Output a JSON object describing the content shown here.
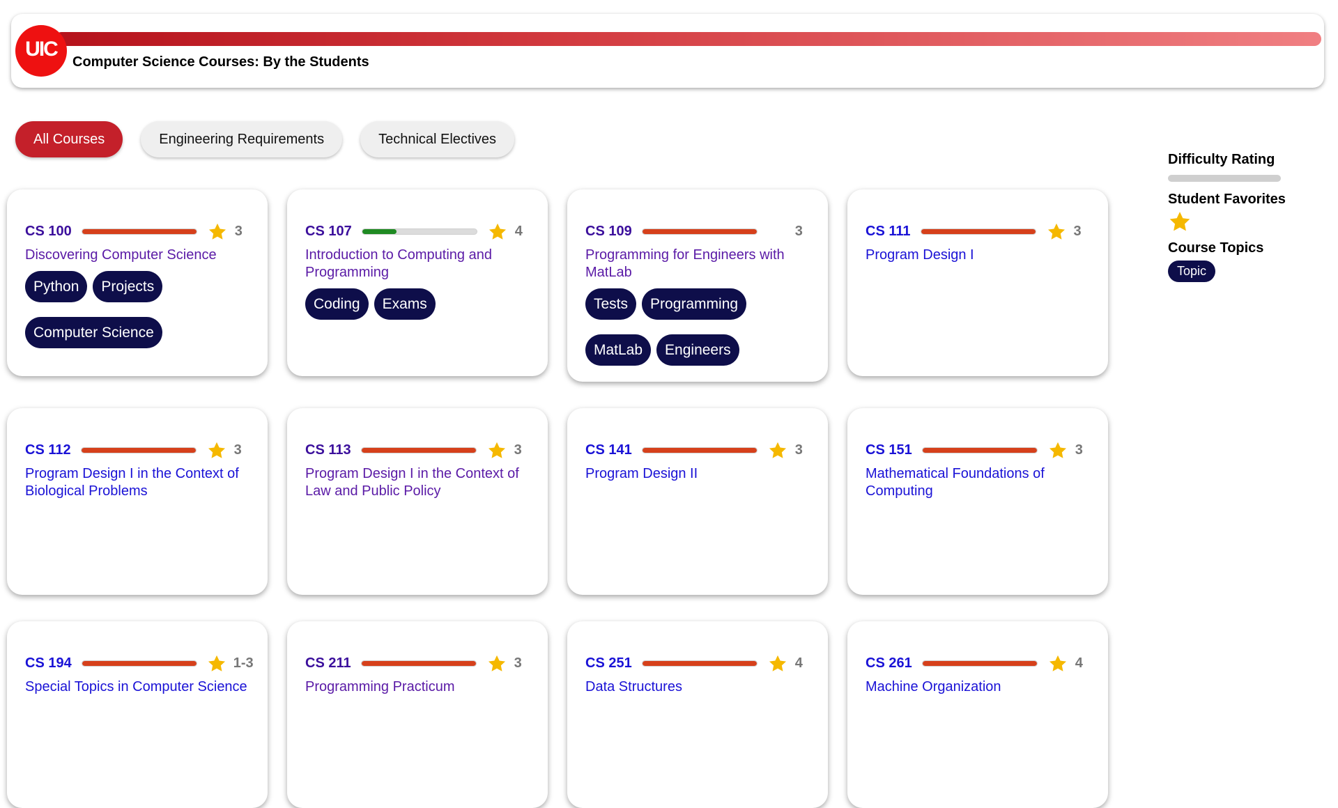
{
  "header": {
    "logo_text": "UIC",
    "title": "Computer Science Courses: By the Students"
  },
  "tabs": [
    {
      "label": "All Courses",
      "active": true
    },
    {
      "label": "Engineering Requirements",
      "active": false
    },
    {
      "label": "Technical Electives",
      "active": false
    }
  ],
  "legend": {
    "difficulty_heading": "Difficulty Rating",
    "favorites_heading": "Student Favorites",
    "topics_heading": "Course Topics",
    "topic_sample": "Topic"
  },
  "colors": {
    "brand_red": "#c4202a",
    "difficulty_high": "#d6401b",
    "difficulty_low": "#1f8a22",
    "star": "#f5b800",
    "topic_bg": "#0e0e4a"
  },
  "courses": [
    {
      "code": "CS 100",
      "name": "Discovering Computer Science",
      "rating": "3",
      "difficulty": 1.0,
      "favorite": true,
      "visited": true,
      "topics": [
        "Python",
        "Projects",
        "Computer Science"
      ]
    },
    {
      "code": "CS 107",
      "name": "Introduction to Computing and Programming",
      "rating": "4",
      "difficulty": 0.3,
      "favorite": true,
      "visited": true,
      "topics": [
        "Coding",
        "Exams"
      ]
    },
    {
      "code": "CS 109",
      "name": "Programming for Engineers with MatLab",
      "rating": "3",
      "difficulty": 1.0,
      "favorite": false,
      "visited": true,
      "topics": [
        "Tests",
        "Programming",
        "MatLab",
        "Engineers"
      ]
    },
    {
      "code": "CS 111",
      "name": "Program Design I",
      "rating": "3",
      "difficulty": 1.0,
      "favorite": true,
      "visited": false,
      "topics": []
    },
    {
      "code": "CS 112",
      "name": "Program Design I in the Context of Biological Problems",
      "rating": "3",
      "difficulty": 1.0,
      "favorite": true,
      "visited": false,
      "topics": []
    },
    {
      "code": "CS 113",
      "name": "Program Design I in the Context of Law and Public Policy",
      "rating": "3",
      "difficulty": 1.0,
      "favorite": true,
      "visited": true,
      "topics": []
    },
    {
      "code": "CS 141",
      "name": "Program Design II",
      "rating": "3",
      "difficulty": 1.0,
      "favorite": true,
      "visited": false,
      "topics": []
    },
    {
      "code": "CS 151",
      "name": "Mathematical Foundations of Computing",
      "rating": "3",
      "difficulty": 1.0,
      "favorite": true,
      "visited": false,
      "topics": []
    },
    {
      "code": "CS 194",
      "name": "Special Topics in Computer Science",
      "rating": "1-3",
      "difficulty": 1.0,
      "favorite": true,
      "visited": false,
      "topics": []
    },
    {
      "code": "CS 211",
      "name": "Programming Practicum",
      "rating": "3",
      "difficulty": 1.0,
      "favorite": true,
      "visited": true,
      "topics": []
    },
    {
      "code": "CS 251",
      "name": "Data Structures",
      "rating": "4",
      "difficulty": 1.0,
      "favorite": true,
      "visited": false,
      "topics": []
    },
    {
      "code": "CS 261",
      "name": "Machine Organization",
      "rating": "4",
      "difficulty": 1.0,
      "favorite": true,
      "visited": false,
      "topics": []
    }
  ]
}
